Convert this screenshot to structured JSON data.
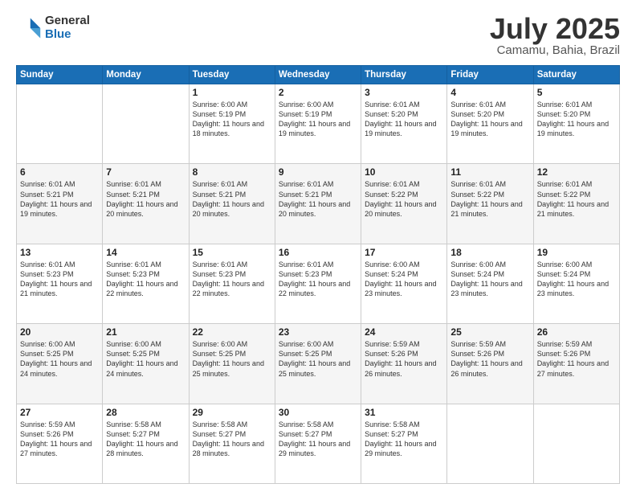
{
  "logo": {
    "general": "General",
    "blue": "Blue"
  },
  "title": {
    "month_year": "July 2025",
    "location": "Camamu, Bahia, Brazil"
  },
  "weekdays": [
    "Sunday",
    "Monday",
    "Tuesday",
    "Wednesday",
    "Thursday",
    "Friday",
    "Saturday"
  ],
  "weeks": [
    [
      {
        "day": "",
        "info": ""
      },
      {
        "day": "",
        "info": ""
      },
      {
        "day": "1",
        "info": "Sunrise: 6:00 AM\nSunset: 5:19 PM\nDaylight: 11 hours and 18 minutes."
      },
      {
        "day": "2",
        "info": "Sunrise: 6:00 AM\nSunset: 5:19 PM\nDaylight: 11 hours and 19 minutes."
      },
      {
        "day": "3",
        "info": "Sunrise: 6:01 AM\nSunset: 5:20 PM\nDaylight: 11 hours and 19 minutes."
      },
      {
        "day": "4",
        "info": "Sunrise: 6:01 AM\nSunset: 5:20 PM\nDaylight: 11 hours and 19 minutes."
      },
      {
        "day": "5",
        "info": "Sunrise: 6:01 AM\nSunset: 5:20 PM\nDaylight: 11 hours and 19 minutes."
      }
    ],
    [
      {
        "day": "6",
        "info": "Sunrise: 6:01 AM\nSunset: 5:21 PM\nDaylight: 11 hours and 19 minutes."
      },
      {
        "day": "7",
        "info": "Sunrise: 6:01 AM\nSunset: 5:21 PM\nDaylight: 11 hours and 20 minutes."
      },
      {
        "day": "8",
        "info": "Sunrise: 6:01 AM\nSunset: 5:21 PM\nDaylight: 11 hours and 20 minutes."
      },
      {
        "day": "9",
        "info": "Sunrise: 6:01 AM\nSunset: 5:21 PM\nDaylight: 11 hours and 20 minutes."
      },
      {
        "day": "10",
        "info": "Sunrise: 6:01 AM\nSunset: 5:22 PM\nDaylight: 11 hours and 20 minutes."
      },
      {
        "day": "11",
        "info": "Sunrise: 6:01 AM\nSunset: 5:22 PM\nDaylight: 11 hours and 21 minutes."
      },
      {
        "day": "12",
        "info": "Sunrise: 6:01 AM\nSunset: 5:22 PM\nDaylight: 11 hours and 21 minutes."
      }
    ],
    [
      {
        "day": "13",
        "info": "Sunrise: 6:01 AM\nSunset: 5:23 PM\nDaylight: 11 hours and 21 minutes."
      },
      {
        "day": "14",
        "info": "Sunrise: 6:01 AM\nSunset: 5:23 PM\nDaylight: 11 hours and 22 minutes."
      },
      {
        "day": "15",
        "info": "Sunrise: 6:01 AM\nSunset: 5:23 PM\nDaylight: 11 hours and 22 minutes."
      },
      {
        "day": "16",
        "info": "Sunrise: 6:01 AM\nSunset: 5:23 PM\nDaylight: 11 hours and 22 minutes."
      },
      {
        "day": "17",
        "info": "Sunrise: 6:00 AM\nSunset: 5:24 PM\nDaylight: 11 hours and 23 minutes."
      },
      {
        "day": "18",
        "info": "Sunrise: 6:00 AM\nSunset: 5:24 PM\nDaylight: 11 hours and 23 minutes."
      },
      {
        "day": "19",
        "info": "Sunrise: 6:00 AM\nSunset: 5:24 PM\nDaylight: 11 hours and 23 minutes."
      }
    ],
    [
      {
        "day": "20",
        "info": "Sunrise: 6:00 AM\nSunset: 5:25 PM\nDaylight: 11 hours and 24 minutes."
      },
      {
        "day": "21",
        "info": "Sunrise: 6:00 AM\nSunset: 5:25 PM\nDaylight: 11 hours and 24 minutes."
      },
      {
        "day": "22",
        "info": "Sunrise: 6:00 AM\nSunset: 5:25 PM\nDaylight: 11 hours and 25 minutes."
      },
      {
        "day": "23",
        "info": "Sunrise: 6:00 AM\nSunset: 5:25 PM\nDaylight: 11 hours and 25 minutes."
      },
      {
        "day": "24",
        "info": "Sunrise: 5:59 AM\nSunset: 5:26 PM\nDaylight: 11 hours and 26 minutes."
      },
      {
        "day": "25",
        "info": "Sunrise: 5:59 AM\nSunset: 5:26 PM\nDaylight: 11 hours and 26 minutes."
      },
      {
        "day": "26",
        "info": "Sunrise: 5:59 AM\nSunset: 5:26 PM\nDaylight: 11 hours and 27 minutes."
      }
    ],
    [
      {
        "day": "27",
        "info": "Sunrise: 5:59 AM\nSunset: 5:26 PM\nDaylight: 11 hours and 27 minutes."
      },
      {
        "day": "28",
        "info": "Sunrise: 5:58 AM\nSunset: 5:27 PM\nDaylight: 11 hours and 28 minutes."
      },
      {
        "day": "29",
        "info": "Sunrise: 5:58 AM\nSunset: 5:27 PM\nDaylight: 11 hours and 28 minutes."
      },
      {
        "day": "30",
        "info": "Sunrise: 5:58 AM\nSunset: 5:27 PM\nDaylight: 11 hours and 29 minutes."
      },
      {
        "day": "31",
        "info": "Sunrise: 5:58 AM\nSunset: 5:27 PM\nDaylight: 11 hours and 29 minutes."
      },
      {
        "day": "",
        "info": ""
      },
      {
        "day": "",
        "info": ""
      }
    ]
  ]
}
